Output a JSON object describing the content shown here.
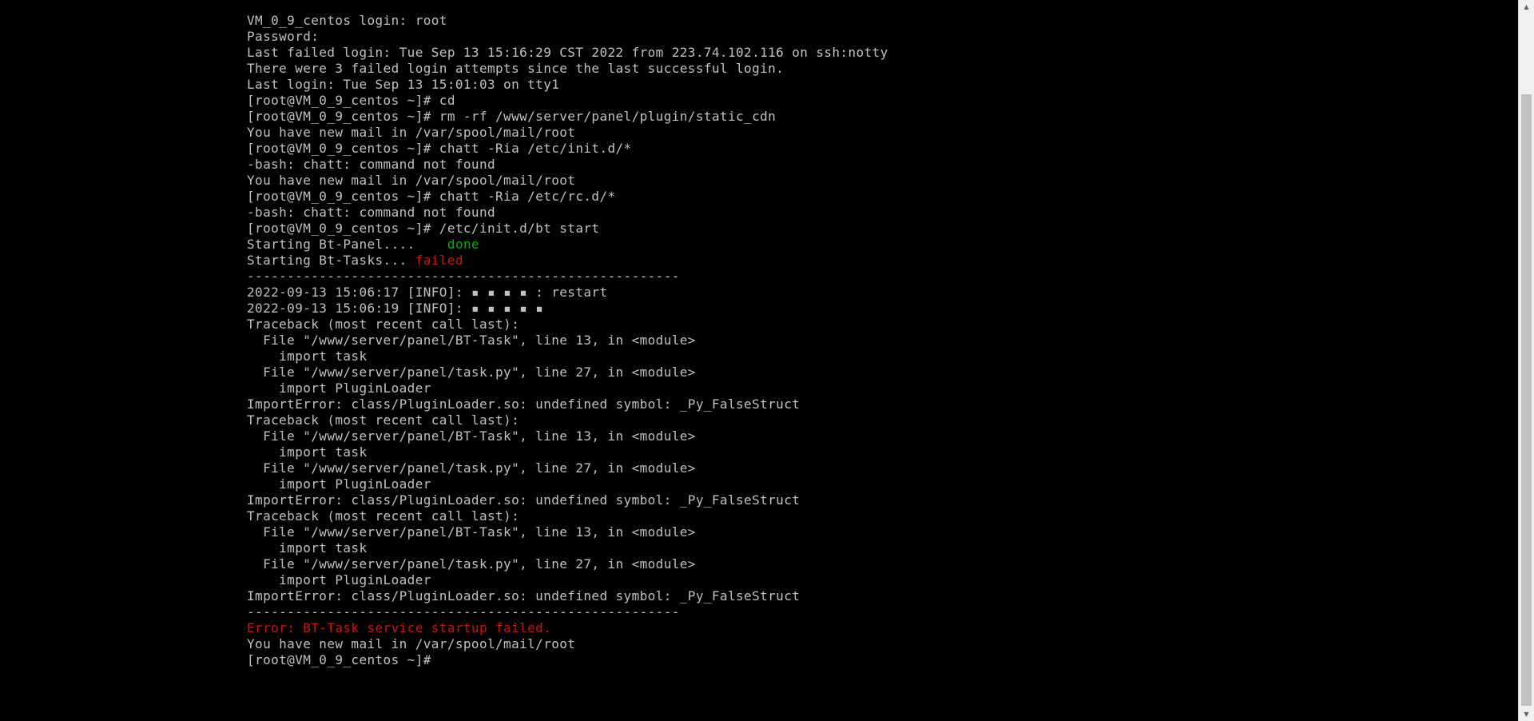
{
  "terminal": {
    "lines": [
      [
        {
          "t": "VM_0_9_centos login: root"
        }
      ],
      [
        {
          "t": "Password:"
        }
      ],
      [
        {
          "t": "Last failed login: Tue Sep 13 15:16:29 CST 2022 from 223.74.102.116 on ssh:notty"
        }
      ],
      [
        {
          "t": "There were 3 failed login attempts since the last successful login."
        }
      ],
      [
        {
          "t": "Last login: Tue Sep 13 15:01:03 on tty1"
        }
      ],
      [
        {
          "t": "[root@VM_0_9_centos ~]# cd"
        }
      ],
      [
        {
          "t": "[root@VM_0_9_centos ~]# rm -rf /www/server/panel/plugin/static_cdn"
        }
      ],
      [
        {
          "t": "You have new mail in /var/spool/mail/root"
        }
      ],
      [
        {
          "t": "[root@VM_0_9_centos ~]# chatt -Ria /etc/init.d/*"
        }
      ],
      [
        {
          "t": "-bash: chatt: command not found"
        }
      ],
      [
        {
          "t": "You have new mail in /var/spool/mail/root"
        }
      ],
      [
        {
          "t": "[root@VM_0_9_centos ~]# chatt -Ria /etc/rc.d/*"
        }
      ],
      [
        {
          "t": "-bash: chatt: command not found"
        }
      ],
      [
        {
          "t": "[root@VM_0_9_centos ~]# /etc/init.d/bt start"
        }
      ],
      [
        {
          "t": "Starting Bt-Panel....    "
        },
        {
          "t": "done",
          "c": "ok"
        }
      ],
      [
        {
          "t": "Starting Bt-Tasks... "
        },
        {
          "t": "failed",
          "c": "fail"
        }
      ],
      [
        {
          "t": "------------------------------------------------------"
        }
      ],
      [
        {
          "t": "2022-09-13 15:06:17 [INFO]: ▪ ▪ ▪ ▪ : restart"
        }
      ],
      [
        {
          "t": "2022-09-13 15:06:19 [INFO]: ▪ ▪ ▪ ▪ ▪"
        }
      ],
      [
        {
          "t": "Traceback (most recent call last):"
        }
      ],
      [
        {
          "t": "  File \"/www/server/panel/BT-Task\", line 13, in <module>"
        }
      ],
      [
        {
          "t": "    import task"
        }
      ],
      [
        {
          "t": "  File \"/www/server/panel/task.py\", line 27, in <module>"
        }
      ],
      [
        {
          "t": "    import PluginLoader"
        }
      ],
      [
        {
          "t": "ImportError: class/PluginLoader.so: undefined symbol: _Py_FalseStruct"
        }
      ],
      [
        {
          "t": "Traceback (most recent call last):"
        }
      ],
      [
        {
          "t": "  File \"/www/server/panel/BT-Task\", line 13, in <module>"
        }
      ],
      [
        {
          "t": "    import task"
        }
      ],
      [
        {
          "t": "  File \"/www/server/panel/task.py\", line 27, in <module>"
        }
      ],
      [
        {
          "t": "    import PluginLoader"
        }
      ],
      [
        {
          "t": "ImportError: class/PluginLoader.so: undefined symbol: _Py_FalseStruct"
        }
      ],
      [
        {
          "t": "Traceback (most recent call last):"
        }
      ],
      [
        {
          "t": "  File \"/www/server/panel/BT-Task\", line 13, in <module>"
        }
      ],
      [
        {
          "t": "    import task"
        }
      ],
      [
        {
          "t": "  File \"/www/server/panel/task.py\", line 27, in <module>"
        }
      ],
      [
        {
          "t": "    import PluginLoader"
        }
      ],
      [
        {
          "t": "ImportError: class/PluginLoader.so: undefined symbol: _Py_FalseStruct"
        }
      ],
      [
        {
          "t": "------------------------------------------------------"
        }
      ],
      [
        {
          "t": "Error: BT-Task service startup failed.",
          "c": "fail"
        }
      ],
      [
        {
          "t": "You have new mail in /var/spool/mail/root"
        }
      ],
      [
        {
          "t": "[root@VM_0_9_centos ~]# "
        }
      ]
    ]
  },
  "colors": {
    "background": "#000000",
    "text": "#c0c0c0",
    "ok": "#00b000",
    "fail": "#d01010"
  },
  "scrollbar": {
    "up_icon": "▲",
    "down_icon": "▼"
  }
}
